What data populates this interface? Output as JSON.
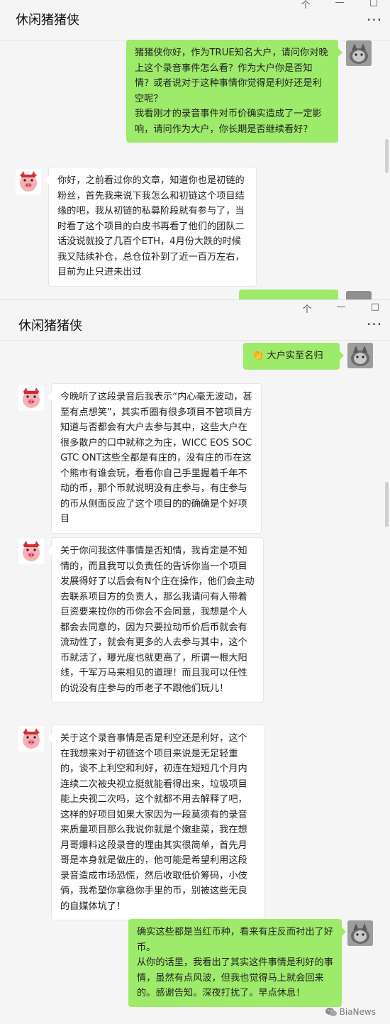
{
  "window_controls": {
    "pin": "个",
    "minimize": "—",
    "maximize": "□",
    "close": "×"
  },
  "chat": {
    "title": "休闲猪猪侠",
    "more_label": "···"
  },
  "messages_window1": [
    {
      "sender": "self",
      "lines": [
        "猪猪侠你好，作为TRUE知名大户，请问你对晚上这个录音事件怎么看？作为大户你是否知情？或者说对于这种事情你觉得是利好还是利空呢？",
        "我看刚才的录音事件对币价确实造成了一定影响，请问作为大户，你长期是否继续看好？"
      ]
    },
    {
      "sender": "other",
      "lines": [
        "你好，之前看过你的文章，知道你也是初链的粉丝，首先我来说下我怎么和初链这个项目结缘的吧，我从初链的私募阶段就有参与了，当时看了这个项目的白皮书再看了他们的团队二话没说就投了几百个ETH，4月份大跌的时候我又陆续补仓，总仓位补到了近一百万左右，目前为止只进未出过"
      ]
    }
  ],
  "messages_window2": [
    {
      "sender": "self",
      "emoji": "👏",
      "lines": [
        "大户实至名归"
      ]
    },
    {
      "sender": "other",
      "lines": [
        "今晚听了这段录音后我表示“内心毫无波动，甚至有点想笑”，其实币圈有很多项目不管项目方知道与否都会有大户去参与其中，这些大户在很多散户的口中就称之为庄，WICC EOS SOC GTC ONT这些全都是有庄的，没有庄的币在这个熊市有谁会玩，看看你自己手里握着千年不动的币，那个币就说明没有庄参与，有庄参与的币从侧面反应了这个项目的的确确是个好项目"
      ]
    },
    {
      "sender": "other",
      "lines": [
        "关于你问我这件事情是否知情，我肯定是不知情的，而且我可以负责任的告诉你当一个项目发展得好了以后会有N个庄在操作，他们会主动去联系项目方的负责人，那么我请问有人带着巨资要来拉你的币你会不会同意，我想是个人都会去同意的，因为只要拉动币价后币就会有流动性了，就会有更多的人去参与其中，这个币就活了，曝光度也就更高了，所谓一根大阳线，千军万马来相见的道理！而且我可以任性的说没有庄参与的币老子不跟他们玩儿！"
      ]
    },
    {
      "sender": "other",
      "lines": [
        "关于这个录音事情是否是利空还是利好，这个在我想来对于初链这个项目来说是无足轻重的，谈不上利空和利好，初连在短短几个月内连续二次被央视立挺就能看得出来，垃圾项目能上央视二次吗，这个就都不用去解释了吧，这样的好项目如果大家因为一段莫须有的录音来质量项目那么我说你就是个嫩韭菜，我在想月哥爆料这段录音的理由其实很简单，首先月哥是本身就是做庄的，他可能是希望利用这段录音造成市场恐慌，然后收取低价筹码，小伎俩，我希望你拿稳你手里的币，别被这些无良的自媒体坑了！"
      ]
    },
    {
      "sender": "self",
      "lines": [
        "确实这些都是当红币种，看来有庄反而衬出了好币。",
        "从你的话里，我看出了其实这件事情是利好的事情，虽然有点风波，但我也觉得马上就会回来的。感谢告知。深夜打扰了。早点休息！"
      ]
    }
  ],
  "watermark": {
    "icon": "wechat-icon",
    "text": "BiaNews"
  }
}
